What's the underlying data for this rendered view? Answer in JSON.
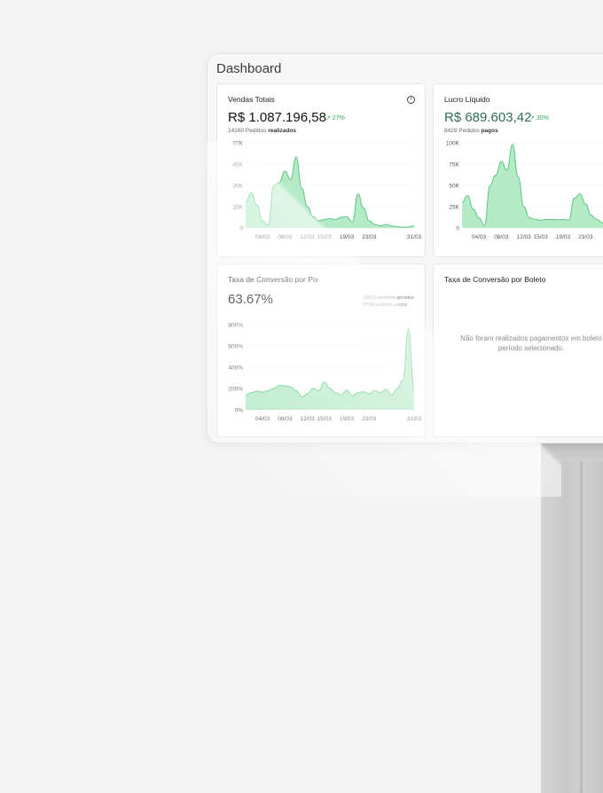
{
  "dashboard": {
    "title": "Dashboard"
  },
  "cards": {
    "vendas": {
      "title": "Vendas Totais",
      "value": "R$ 1.087.196,58",
      "trend": "27%",
      "sub_count": "14160 Pedidos",
      "sub_bold": "realizados"
    },
    "lucro": {
      "title": "Lucro Líquido",
      "value": "R$ 689.603,42",
      "trend": "30%",
      "sub_count": "8429 Pedidos",
      "sub_bold": "pagos"
    },
    "pix": {
      "title": "Taxa de Conversão por Pix",
      "value": "63.67%",
      "note_line1": "10523 pedidos gerados",
      "note_line2": "6700 pedidos pagos"
    },
    "boleto": {
      "title": "Taxa de Conversão por Boleto",
      "empty_line1": "Não foram realizados pagamentos em boleto",
      "empty_line2": "período selecionado."
    }
  },
  "colors": {
    "accent": "#2fae61",
    "area_fill": "#a8e6bd",
    "area_stroke": "#5cc883",
    "teal": "#2e6b5a"
  },
  "chart_data": [
    {
      "type": "area",
      "title": "Vendas Totais",
      "yticks": [
        "0",
        "15K",
        "30K",
        "45K",
        "60K"
      ],
      "ylim": [
        0,
        60000
      ],
      "xticks": [
        "04/03",
        "08/03",
        "12/03",
        "15/03",
        "19/03",
        "23/03",
        "31/03"
      ],
      "x": [
        "01/03",
        "02/03",
        "03/03",
        "04/03",
        "05/03",
        "06/03",
        "07/03",
        "08/03",
        "09/03",
        "10/03",
        "11/03",
        "12/03",
        "13/03",
        "14/03",
        "15/03",
        "16/03",
        "17/03",
        "18/03",
        "19/03",
        "20/03",
        "21/03",
        "22/03",
        "23/03",
        "24/03",
        "25/03",
        "26/03",
        "27/03",
        "28/03",
        "29/03",
        "30/03",
        "31/03"
      ],
      "values": [
        18000,
        25000,
        16000,
        5000,
        2000,
        30000,
        32000,
        40000,
        34000,
        50000,
        28000,
        15000,
        8000,
        5000,
        6000,
        6500,
        6000,
        7500,
        8000,
        4000,
        24000,
        14000,
        5000,
        2500,
        1500,
        2500,
        1500,
        800,
        500,
        800,
        1500
      ],
      "grid": true
    },
    {
      "type": "area",
      "title": "Lucro Líquido",
      "yticks": [
        "0",
        "25K",
        "50K",
        "75K",
        "100K"
      ],
      "ylim": [
        0,
        100000
      ],
      "xticks": [
        "04/03",
        "08/03",
        "12/03",
        "15/03",
        "19/03",
        "23/03"
      ],
      "x": [
        "01/03",
        "02/03",
        "03/03",
        "04/03",
        "05/03",
        "06/03",
        "07/03",
        "08/03",
        "09/03",
        "10/03",
        "11/03",
        "12/03",
        "13/03",
        "14/03",
        "15/03",
        "16/03",
        "17/03",
        "18/03",
        "19/03",
        "20/03",
        "21/03",
        "22/03",
        "23/03",
        "24/03",
        "25/03",
        "26/03",
        "27/03"
      ],
      "values": [
        30000,
        38000,
        22000,
        12000,
        3000,
        50000,
        62000,
        78000,
        68000,
        98000,
        60000,
        25000,
        12000,
        10000,
        9000,
        10000,
        10000,
        9500,
        10000,
        9000,
        35000,
        40000,
        28000,
        15000,
        10000,
        6000,
        5000
      ],
      "grid": true
    },
    {
      "type": "area",
      "title": "Taxa de Conversão por Pix",
      "yticks": [
        "0%",
        "200%",
        "400%",
        "600%",
        "800%"
      ],
      "ylim": [
        0,
        800
      ],
      "xticks": [
        "04/03",
        "08/03",
        "12/03",
        "15/03",
        "19/03",
        "23/03",
        "31/03"
      ],
      "x": [
        "01/03",
        "02/03",
        "03/03",
        "04/03",
        "05/03",
        "06/03",
        "07/03",
        "08/03",
        "09/03",
        "10/03",
        "11/03",
        "12/03",
        "13/03",
        "14/03",
        "15/03",
        "16/03",
        "17/03",
        "18/03",
        "19/03",
        "20/03",
        "21/03",
        "22/03",
        "23/03",
        "24/03",
        "25/03",
        "26/03",
        "27/03",
        "28/03",
        "29/03",
        "30/03",
        "31/03"
      ],
      "values": [
        140,
        160,
        175,
        165,
        180,
        200,
        230,
        225,
        215,
        180,
        120,
        150,
        200,
        180,
        260,
        200,
        160,
        140,
        185,
        130,
        160,
        170,
        150,
        180,
        160,
        190,
        140,
        200,
        280,
        760,
        200
      ],
      "grid": true
    }
  ]
}
